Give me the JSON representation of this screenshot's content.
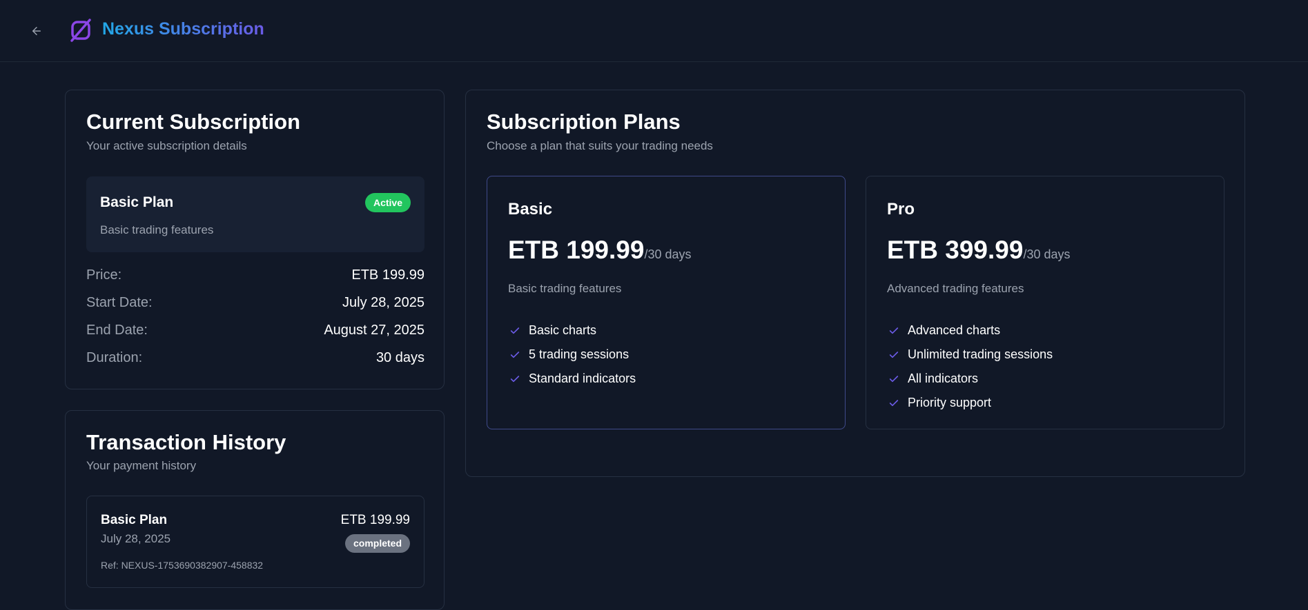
{
  "header": {
    "back_icon": "arrow-left-icon",
    "logo_icon": "nexus-logo-icon",
    "title": "Nexus Subscription"
  },
  "current_subscription": {
    "title": "Current Subscription",
    "subtitle": "Your active subscription details",
    "plan_name": "Basic Plan",
    "plan_description": "Basic trading features",
    "status": "Active",
    "details": [
      {
        "label": "Price:",
        "value": "ETB 199.99"
      },
      {
        "label": "Start Date:",
        "value": "July 28, 2025"
      },
      {
        "label": "End Date:",
        "value": "August 27, 2025"
      },
      {
        "label": "Duration:",
        "value": "30 days"
      }
    ]
  },
  "transaction_history": {
    "title": "Transaction History",
    "subtitle": "Your payment history",
    "items": [
      {
        "plan": "Basic Plan",
        "date": "July 28, 2025",
        "amount": "ETB 199.99",
        "status": "completed",
        "reference": "Ref: NEXUS-1753690382907-458832"
      }
    ]
  },
  "subscription_plans": {
    "title": "Subscription Plans",
    "subtitle": "Choose a plan that suits your trading needs",
    "plans": [
      {
        "name": "Basic",
        "price": "ETB 199.99",
        "period": "/30 days",
        "description": "Basic trading features",
        "features": [
          "Basic charts",
          "5 trading sessions",
          "Standard indicators"
        ]
      },
      {
        "name": "Pro",
        "price": "ETB 399.99",
        "period": "/30 days",
        "description": "Advanced trading features",
        "features": [
          "Advanced charts",
          "Unlimited trading sessions",
          "All indicators",
          "Priority support"
        ]
      }
    ]
  },
  "colors": {
    "background": "#111827",
    "accent": "#6b5be6",
    "active": "#22c55e",
    "completed": "#6b7280"
  }
}
